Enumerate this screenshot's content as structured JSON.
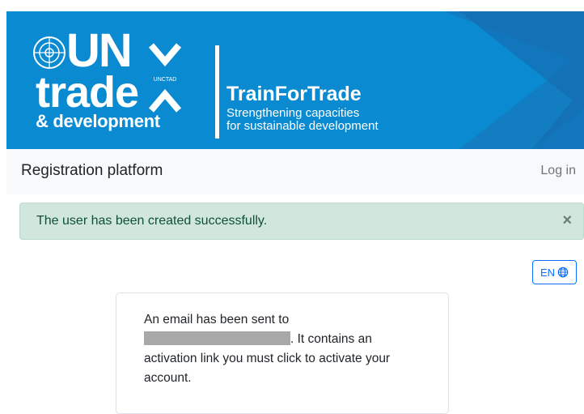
{
  "banner": {
    "un": "UN",
    "trade": "trade",
    "development": "& development",
    "unctad": "UNCTAD",
    "title": "TrainForTrade",
    "subtitle_line1": "Strengthening capacities",
    "subtitle_line2": "for sustainable development",
    "colors": {
      "background": "#0a8ad1",
      "stripe": "#1b6aa8"
    }
  },
  "navbar": {
    "brand": "Registration platform",
    "login": "Log in"
  },
  "alert": {
    "message": "The user has been created successfully.",
    "close": "×",
    "colors": {
      "background": "#d1e7dd",
      "text": "#0f5132"
    }
  },
  "language": {
    "label": "EN",
    "icon": "globe-icon"
  },
  "card": {
    "line1": "An email has been sent to",
    "line2_suffix": ". It contains an",
    "line3": "activation link you must click to activate your",
    "line4": "account."
  }
}
